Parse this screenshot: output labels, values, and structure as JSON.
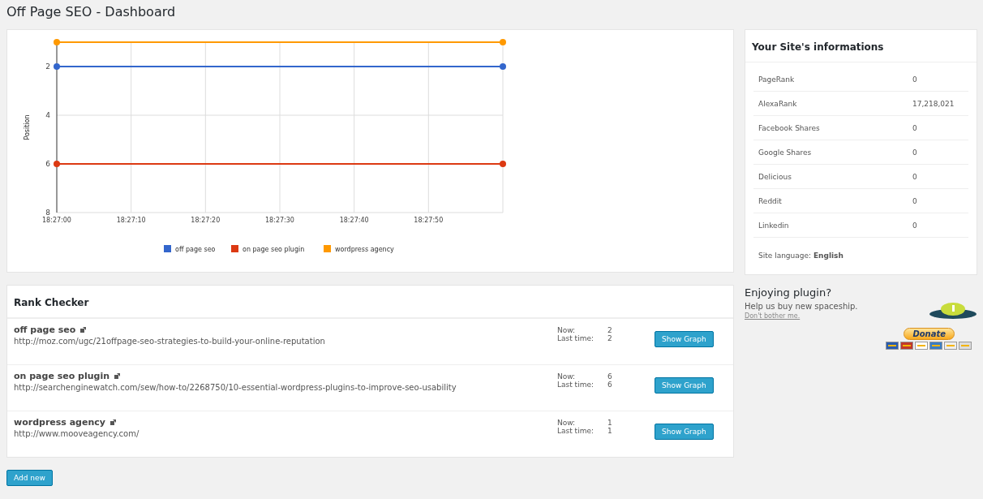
{
  "page_title": "Off Page SEO - Dashboard",
  "position_chart": {
    "chart_data": {
      "type": "line",
      "ylabel": "Position",
      "categories": [
        "18:27:00",
        "18:27:10",
        "18:27:20",
        "18:27:30",
        "18:27:40",
        "18:27:50",
        null
      ],
      "ylim": [
        8,
        1
      ],
      "grid": true,
      "legend": "bottom",
      "yticks": [
        2,
        4,
        6,
        8
      ],
      "series": [
        {
          "name": "off page seo",
          "color": "#3366cc",
          "values": [
            2,
            2,
            2,
            2,
            2,
            2,
            2
          ]
        },
        {
          "name": "on page seo plugin",
          "color": "#dc3912",
          "values": [
            6,
            6,
            6,
            6,
            6,
            6,
            6
          ]
        },
        {
          "name": "wordpress agency",
          "color": "#ff9900",
          "values": [
            1,
            1,
            1,
            1,
            1,
            1,
            1
          ]
        }
      ]
    }
  },
  "site_info": {
    "title": "Your Site's informations",
    "rows": [
      {
        "label": "PageRank",
        "value": "0"
      },
      {
        "label": "AlexaRank",
        "value": "17,218,021"
      },
      {
        "label": "Facebook Shares",
        "value": "0"
      },
      {
        "label": "Google Shares",
        "value": "0"
      },
      {
        "label": "Delicious",
        "value": "0"
      },
      {
        "label": "Reddit",
        "value": "0"
      },
      {
        "label": "Linkedin",
        "value": "0"
      }
    ],
    "language": "Site language: **English**"
  },
  "donate": {
    "heading": "Enjoying plugin?",
    "text": "Help us buy new spaceship.",
    "dismiss_link": "Don't bother me.",
    "button": "Donate"
  },
  "rank_checker": {
    "title": "Rank Checker",
    "rows": [
      {
        "keyword": "off page seo",
        "url": "http://moz.com/ugc/21offpage-seo-strategies-to-build-your-online-reputation",
        "now_label": "Now:",
        "now": "2",
        "last_label": "Last time:",
        "last": "2",
        "button": "Show Graph"
      },
      {
        "keyword": "on page seo plugin",
        "url": "http://searchenginewatch.com/sew/how-to/2268750/10-essential-wordpress-plugins-to-improve-seo-usability",
        "now_label": "Now:",
        "now": "6",
        "last_label": "Last time:",
        "last": "6",
        "button": "Show Graph"
      },
      {
        "keyword": "wordpress agency",
        "url": "http://www.mooveagency.com/",
        "now_label": "Now:",
        "now": "1",
        "last_label": "Last time:",
        "last": "1",
        "button": "Show Graph"
      }
    ]
  },
  "add_button": "Add new"
}
